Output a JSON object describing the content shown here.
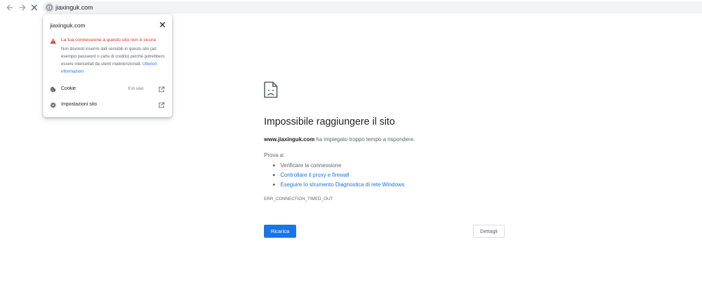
{
  "browser": {
    "url": "jiaxinguk.com",
    "icons": {
      "back": "arrow-left-icon",
      "forward": "arrow-right-icon",
      "stop": "close-icon",
      "site_info": "info-icon"
    }
  },
  "site_info_popup": {
    "title": "jiaxinguk.com",
    "warning": {
      "title": "La tua connessione a questo sito non è sicura",
      "body": "Non dovresti inserire dati sensibili in questo sito (ad esempio password o carte di credito) perché potrebbero essere intercettati da utenti malintenzionati.",
      "link": "Ulteriori informazioni",
      "color": "#d93025"
    },
    "rows": [
      {
        "label": "Cookie",
        "meta": "0 in uso",
        "icon": "cookie-icon"
      },
      {
        "label": "Impostazioni sito",
        "meta": "",
        "icon": "gear-icon"
      }
    ]
  },
  "error_page": {
    "title": "Impossibile raggiungere il sito",
    "domain": "www.jiaxinguk.com",
    "description": " ha impiegato troppo tempo a rispondere.",
    "try_label": "Prova a:",
    "suggestions": [
      {
        "text": "Verificare la connessione",
        "link": false
      },
      {
        "text": "Controllare il proxy e firewall",
        "link": true
      },
      {
        "text": "Eseguire lo strumento Diagnostica di rete Windows",
        "link": true
      }
    ],
    "error_code": "ERR_CONNECTION_TIMED_OUT",
    "reload_label": "Ricarica",
    "details_label": "Dettagli",
    "accent_color": "#1a73e8"
  }
}
